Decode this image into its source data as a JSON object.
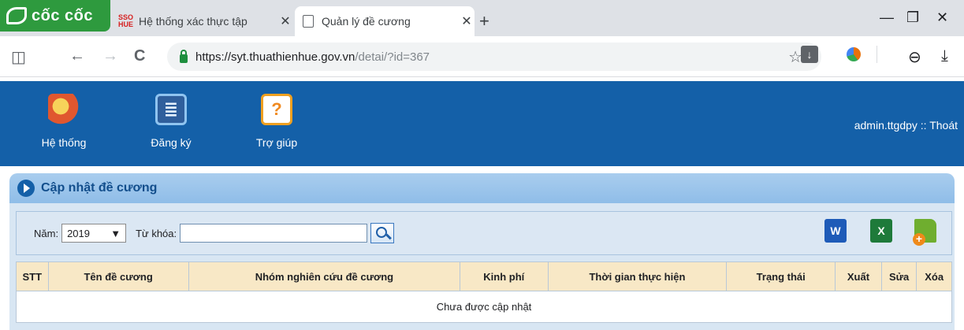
{
  "browser": {
    "brand": "cốc cốc",
    "tabs": [
      {
        "title": "Hệ thống xác thực tập",
        "favicon_text": "SSO HUE",
        "active": false
      },
      {
        "title": "Quản lý đề cương",
        "active": true
      }
    ],
    "new_tab": "+",
    "window": {
      "minimize": "—",
      "restore": "❐",
      "close": "✕"
    },
    "nav": {
      "back": "←",
      "forward": "→",
      "reload": "C",
      "sidebar": "◫"
    },
    "url_host": "https://syt.thuathienhue.gov.vn",
    "url_path": "/detai/?id=367",
    "bookmark": "☆",
    "download": "↓",
    "account": "⊖",
    "save": "⤓"
  },
  "header": {
    "menu": [
      {
        "label": "Hệ thống",
        "icon": "system-gear-icon"
      },
      {
        "label": "Đăng ký",
        "icon": "register-form-icon"
      },
      {
        "label": "Trợ giúp",
        "icon": "help-icon"
      }
    ],
    "help_glyph": "?",
    "user": "admin.ttgdpy :: Thoát"
  },
  "panel": {
    "title": "Cập nhật đề cương"
  },
  "filter": {
    "year_label": "Năm:",
    "year_value": "2019",
    "keyword_label": "Từ khóa:",
    "keyword_value": ""
  },
  "actions": {
    "word": "W",
    "excel": "X"
  },
  "table": {
    "columns": [
      "STT",
      "Tên đề cương",
      "Nhóm nghiên cứu đề cương",
      "Kinh phí",
      "Thời gian thực hiện",
      "Trạng thái",
      "Xuất",
      "Sửa",
      "Xóa"
    ],
    "empty_message": "Chưa được cập nhật"
  },
  "colors": {
    "header_blue": "#1460a8",
    "panel_title": "#124e8c",
    "table_head": "#f8e8c6"
  }
}
